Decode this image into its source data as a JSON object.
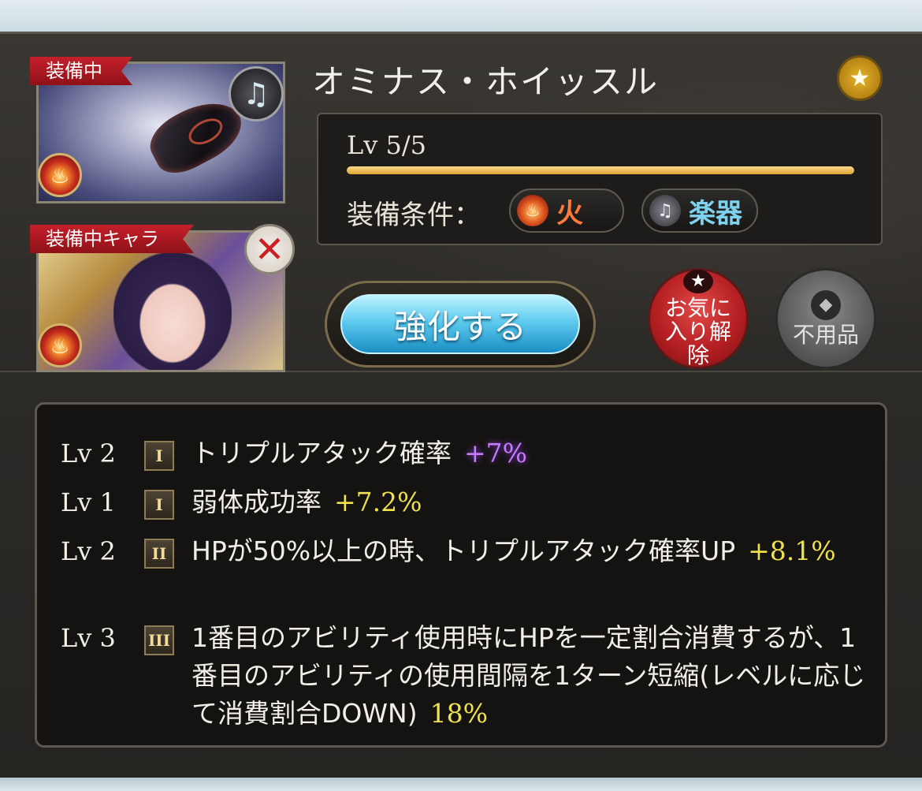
{
  "weapon": {
    "name": "オミナス・ホイッスル",
    "equipped_label": "装備中",
    "element_icon": "fire-icon",
    "type_icon": "harp-icon",
    "favorite_icon": "star-icon"
  },
  "character": {
    "equipped_label": "装備中キャラ",
    "element_icon": "fire-icon",
    "remove_icon": "close-icon"
  },
  "stats": {
    "level": "Lv 5/5",
    "level_fraction": 1.0,
    "requirement_label": "装備条件：",
    "requirements": [
      {
        "icon": "fire-icon",
        "label": "火"
      },
      {
        "icon": "harp-icon",
        "label": "楽器"
      }
    ]
  },
  "actions": {
    "enhance_label": "強化する",
    "unfavorite_label": "お気に入り解除",
    "unneeded_label": "不用品"
  },
  "skills": [
    {
      "lv": "Lv 2",
      "rank": "I",
      "text": "トリプルアタック確率",
      "value": "+7%",
      "value_color": "#c77cff"
    },
    {
      "lv": "Lv 1",
      "rank": "I",
      "text": "弱体成功率",
      "value": "+7.2%",
      "value_color": "#f0e24e"
    },
    {
      "lv": "Lv 2",
      "rank": "II",
      "text": "HPが50%以上の時、トリプルアタック確率UP",
      "value": "+8.1%",
      "value_color": "#f0e24e"
    },
    {
      "lv": "Lv 3",
      "rank": "III",
      "text": "1番目のアビリティ使用時にHPを一定割合消費するが、1番目のアビリティの使用間隔を1ターン短縮(レベルに応じて消費割合DOWN)",
      "value": "18%",
      "value_color": "#f0e24e"
    }
  ]
}
